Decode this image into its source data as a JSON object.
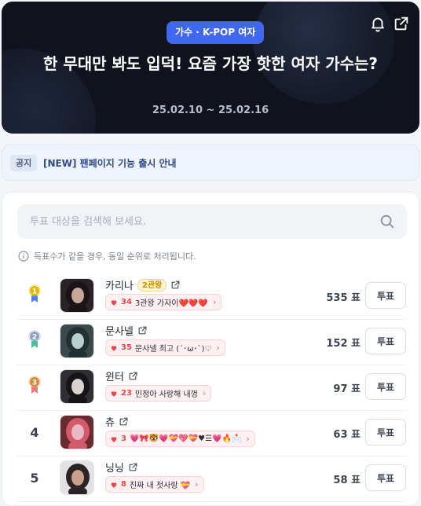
{
  "header": {
    "category_badge": "가수 · K-POP 여자",
    "title": "한 무대만 봐도 입덕! 요즘 가장 핫한 여자 가수는?",
    "date_range": "25.02.10 ~ 25.02.16",
    "icons": [
      "bell-icon",
      "share-icon"
    ]
  },
  "notice": {
    "tag": "공지",
    "text": "[NEW] 팬페이지 기능 출시 안내"
  },
  "search": {
    "placeholder": "투표 대상을 검색해 보세요.",
    "value": ""
  },
  "info_text": "득표수가 같을 경우, 동일 순위로 처리됩니다.",
  "vote_label": "투표",
  "colors": {
    "accent": "#3f67f0",
    "heart": "#e8484d",
    "gold": "#e6b800",
    "silver": "#8fa3c4",
    "bronze": "#d88a3b"
  },
  "rankings": [
    {
      "rank": "1",
      "medal": "gold",
      "name": "카리나",
      "crown": "2관왕",
      "cheer_count": "34",
      "cheer_text": "3관왕 가자이❤️❤️❤️",
      "votes": "535 표"
    },
    {
      "rank": "2",
      "medal": "silver",
      "name": "문사넬",
      "crown": "",
      "cheer_count": "35",
      "cheer_text": "문사넬 최고 (´･ω･`)♡",
      "votes": "152 표"
    },
    {
      "rank": "3",
      "medal": "bronze",
      "name": "윈터",
      "crown": "",
      "cheer_count": "23",
      "cheer_text": "민정아 사랑해 내껑",
      "votes": "97 표"
    },
    {
      "rank": "4",
      "medal": "",
      "name": "츄",
      "crown": "",
      "cheer_count": "3",
      "cheer_text": "💗🎀🐯💗💝💖💝♥☰💗🔥📩",
      "votes": "63 표"
    },
    {
      "rank": "5",
      "medal": "",
      "name": "닝닝",
      "crown": "",
      "cheer_count": "8",
      "cheer_text": "진짜 내 첫사랑 💝",
      "votes": "58 표"
    }
  ]
}
